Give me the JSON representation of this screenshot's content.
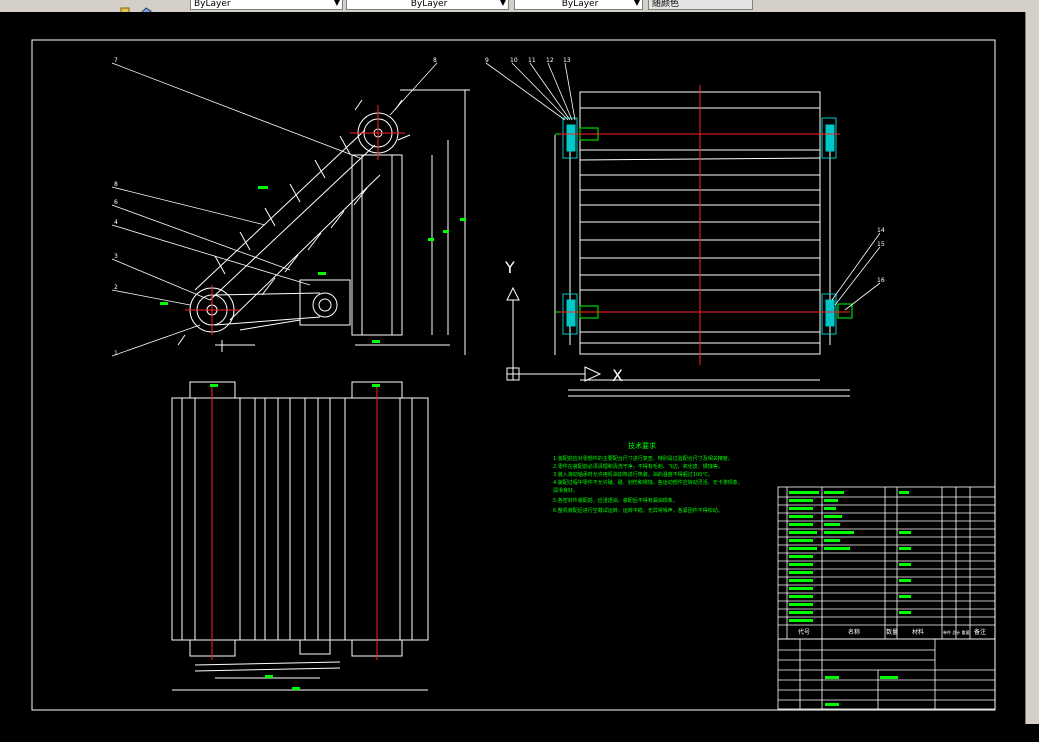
{
  "toolbar": {
    "layer_linetype": "ByLayer",
    "lineweight": "ByLayer",
    "plotstyle": "ByLayer",
    "color_box": "随颜色"
  },
  "drawing": {
    "axis_y": "Y",
    "axis_x": "X",
    "tech_title": "技术要求",
    "tech_lines": [
      "1.装配前应对零部件的主要配合尺寸进行复查，特别是过盈配合尺寸及相关精度。",
      "2.零件在装配前必须清理和清洗干净，不得有毛刺、飞边、氧化皮、锈蚀等。",
      "3.装入滚动轴承时允许用机油加热进行热装，油的温度不得超过100℃。",
      "4.装配过程中零件不允许磕、碰、划伤和锈蚀，各运动部件应转动灵活、无卡滞现象，",
      "  润滑良好。",
      "5.各密封件装配前，应浸透油，装配后不得有漏油现象。",
      "6.整机装配后进行空载试运转，运转平稳，无异常噪声，各紧固件不得松动。"
    ],
    "balloons_left": [
      "7",
      "8",
      "6",
      "5",
      "4",
      "3",
      "2",
      "1"
    ],
    "balloons_top_right": [
      "9",
      "10",
      "11",
      "12",
      "13"
    ],
    "balloons_right": [
      "14",
      "15",
      "16"
    ],
    "title_block": {
      "header_code": "代号",
      "header_name": "名称",
      "header_qty": "数量",
      "header_material": "材料",
      "header_weight": "单件 总计 重量",
      "header_remark": "备注"
    }
  }
}
